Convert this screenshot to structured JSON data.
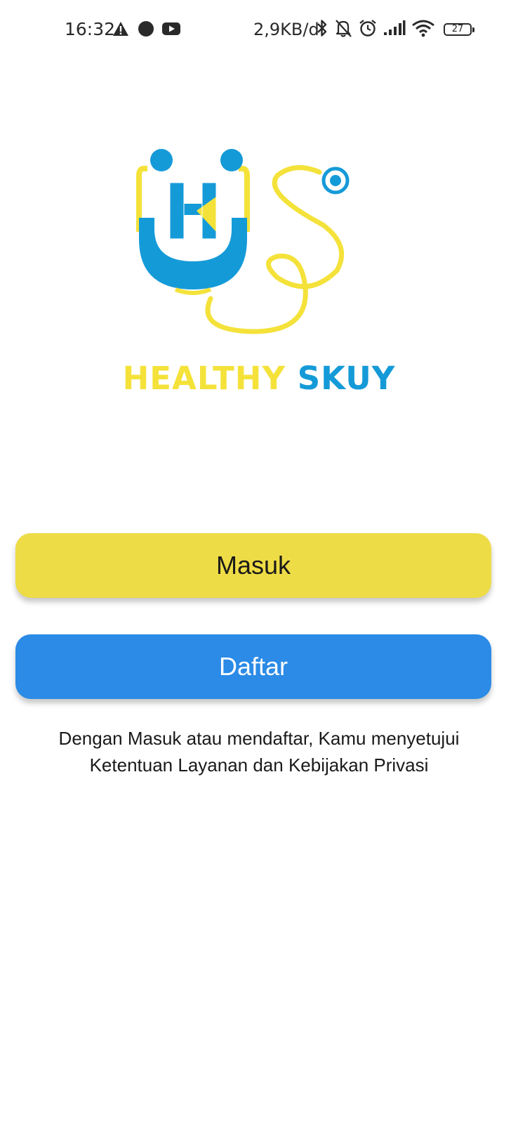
{
  "status_bar": {
    "time": "16:32",
    "network_speed": "2,9KB/d",
    "battery_level": "27",
    "icons_left": [
      "warning-icon",
      "notification-dot-icon",
      "youtube-icon"
    ],
    "icons_right": [
      "bluetooth-icon",
      "bell-off-icon",
      "alarm-icon",
      "signal-icon",
      "wifi-icon",
      "battery-icon"
    ]
  },
  "brand": {
    "name_part1": "HEALTHY",
    "name_part2": "SKUY",
    "logo_letter": "H",
    "color_yellow": "#f4e23a",
    "color_blue": "#159ad8"
  },
  "actions": {
    "login_label": "Masuk",
    "register_label": "Daftar",
    "login_color": "#eedc46",
    "register_color": "#2b8be6"
  },
  "terms": {
    "line1": "Dengan Masuk atau mendaftar, Kamu menyetujui",
    "line2": "Ketentuan Layanan dan Kebijakan Privasi"
  }
}
